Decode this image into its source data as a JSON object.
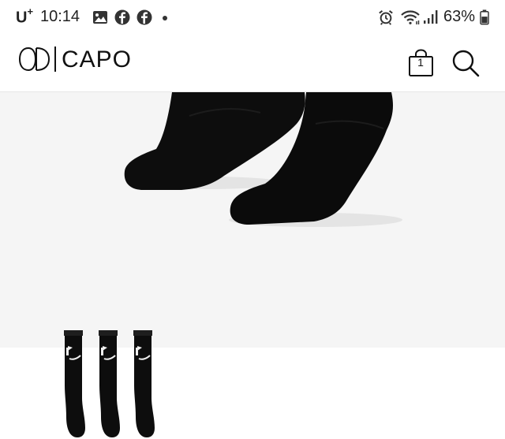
{
  "status_bar": {
    "carrier": "U",
    "carrier_sup": "+",
    "time": "10:14",
    "battery": "63%",
    "icons": [
      "gallery-icon",
      "facebook-icon",
      "facebook-icon",
      "notification-dot-icon",
      "alarm-icon",
      "wifi-icon",
      "signal-icon",
      "battery-icon"
    ]
  },
  "header": {
    "logo_text": "CAPO",
    "cart_count": "1",
    "icons": [
      "cd-logo-icon",
      "cart-icon",
      "search-icon"
    ]
  },
  "product": {
    "main_image": "black-socks-worn-image",
    "thumbnail": "three-pack-black-socks-image",
    "colors": {
      "background": "#f5f5f5",
      "sock": "#0d0d0d"
    }
  }
}
